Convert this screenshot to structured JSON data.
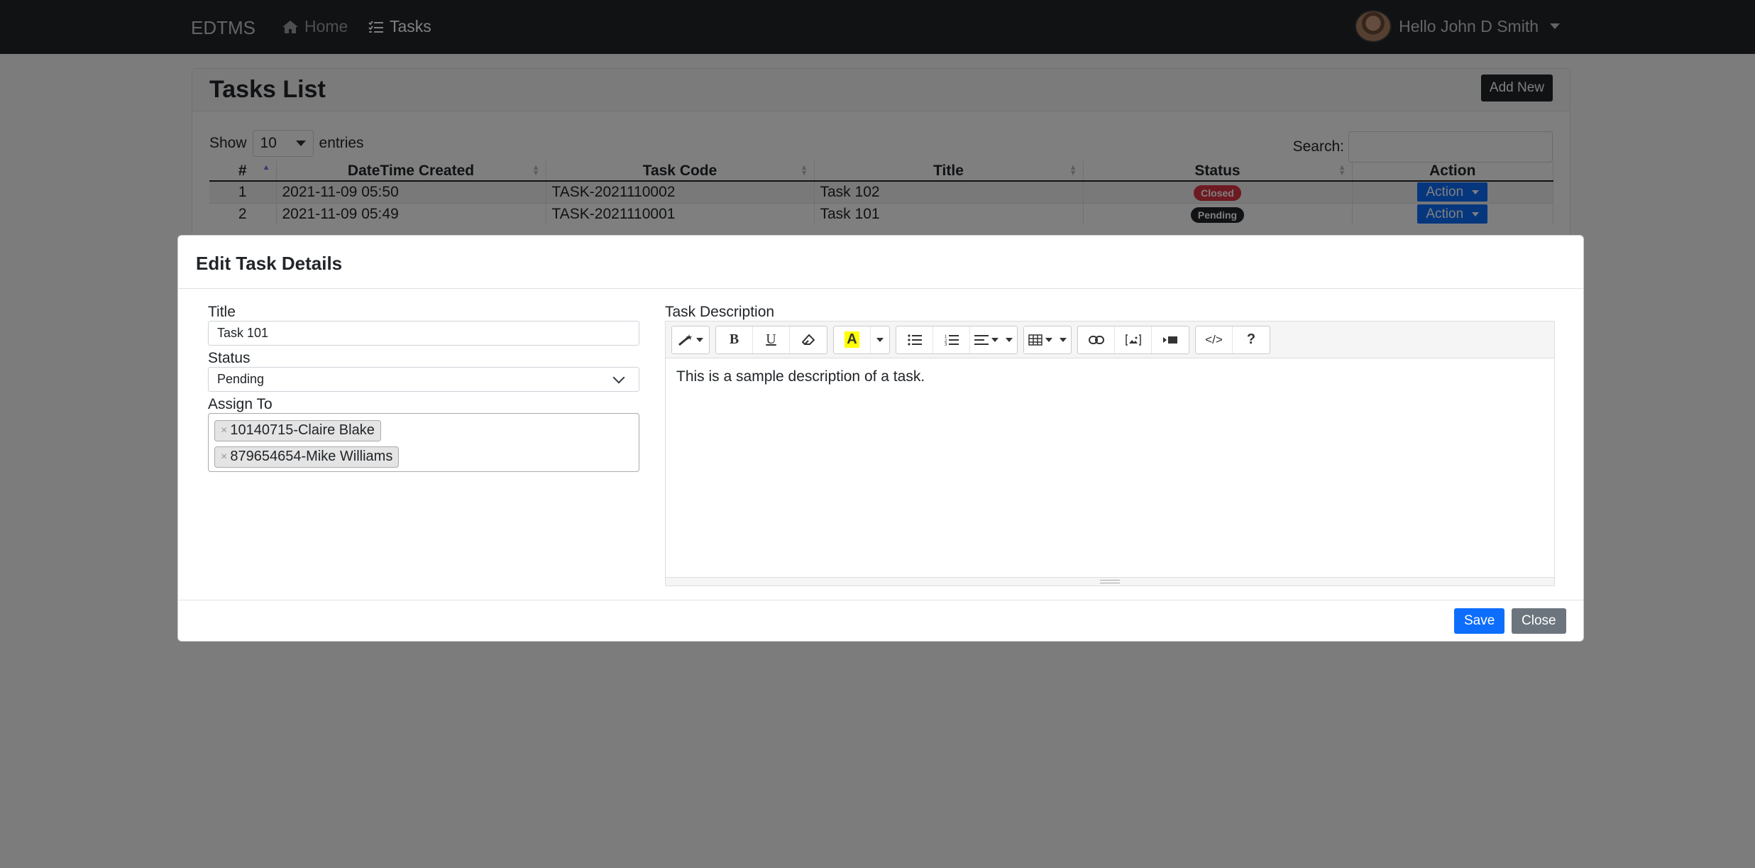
{
  "navbar": {
    "brand": "EDTMS",
    "home": "Home",
    "tasks": "Tasks",
    "user_greeting": "Hello John D Smith"
  },
  "page": {
    "title": "Tasks List",
    "add_new": "Add New",
    "show_label": "Show",
    "entries_value": "10",
    "entries_label": "entries",
    "search_label": "Search:"
  },
  "table": {
    "columns": [
      "#",
      "DateTime Created",
      "Task Code",
      "Title",
      "Status",
      "Action"
    ],
    "rows": [
      {
        "num": "1",
        "created": "2021-11-09 05:50",
        "code": "TASK-2021110002",
        "title": "Task 102",
        "status": "Closed",
        "action": "Action"
      },
      {
        "num": "2",
        "created": "2021-11-09 05:49",
        "code": "TASK-2021110001",
        "title": "Task 101",
        "status": "Pending",
        "action": "Action"
      }
    ]
  },
  "modal": {
    "title": "Edit Task Details",
    "title_label": "Title",
    "title_value": "Task 101",
    "status_label": "Status",
    "status_value": "Pending",
    "assign_label": "Assign To",
    "assignees": [
      "10140715-Claire Blake",
      "879654654-Mike Williams"
    ],
    "description_label": "Task Description",
    "description": "This is a sample description of a task.",
    "save": "Save",
    "close": "Close"
  },
  "colors": {
    "primary": "#0d6efd",
    "danger": "#dc3545",
    "dark": "#212529",
    "secondary": "#6c757d"
  }
}
